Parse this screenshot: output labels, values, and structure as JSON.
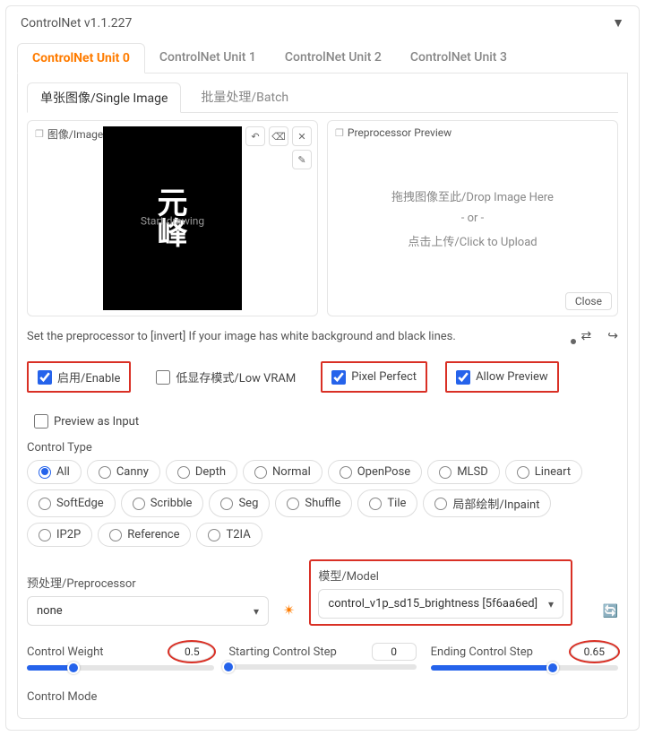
{
  "header": {
    "title": "ControlNet v1.1.227"
  },
  "tabs": [
    "ControlNet Unit 0",
    "ControlNet Unit 1",
    "ControlNet Unit 2",
    "ControlNet Unit 3"
  ],
  "active_tab": 0,
  "subtabs": [
    "单张图像/Single Image",
    "批量处理/Batch"
  ],
  "active_subtab": 0,
  "image_label": "图像/Image",
  "canvas_text1": "元",
  "canvas_text2": "峰",
  "canvas_hint": "Start drawing",
  "preview_label": "Preprocessor Preview",
  "drop_text1": "拖拽图像至此/Drop Image Here",
  "drop_or": "- or -",
  "drop_text2": "点击上传/Click to Upload",
  "close_btn": "Close",
  "note_text": "Set the preprocessor to [invert] If your image has white background and black lines.",
  "checks": [
    {
      "label": "启用/Enable",
      "checked": true,
      "hilite": true
    },
    {
      "label": "低显存模式/Low VRAM",
      "checked": false,
      "hilite": false
    },
    {
      "label": "Pixel Perfect",
      "checked": true,
      "hilite": true
    },
    {
      "label": "Allow Preview",
      "checked": true,
      "hilite": true
    },
    {
      "label": "Preview as Input",
      "checked": false,
      "hilite": false
    }
  ],
  "control_type_label": "Control Type",
  "control_types": [
    "All",
    "Canny",
    "Depth",
    "Normal",
    "OpenPose",
    "MLSD",
    "Lineart",
    "SoftEdge",
    "Scribble",
    "Seg",
    "Shuffle",
    "Tile",
    "局部绘制/Inpaint",
    "IP2P",
    "Reference",
    "T2IA"
  ],
  "control_type_selected": "All",
  "preprocessor_label": "预处理/Preprocessor",
  "preprocessor_value": "none",
  "model_label": "模型/Model",
  "model_value": "control_v1p_sd15_brightness [5f6aa6ed]",
  "sliders": {
    "weight": {
      "label": "Control Weight",
      "value": "0.5",
      "pct": 25,
      "hilite": true
    },
    "start": {
      "label": "Starting Control Step",
      "value": "0",
      "pct": 0,
      "hilite": false
    },
    "end": {
      "label": "Ending Control Step",
      "value": "0.65",
      "pct": 65,
      "hilite": true
    }
  },
  "control_mode_label": "Control Mode"
}
